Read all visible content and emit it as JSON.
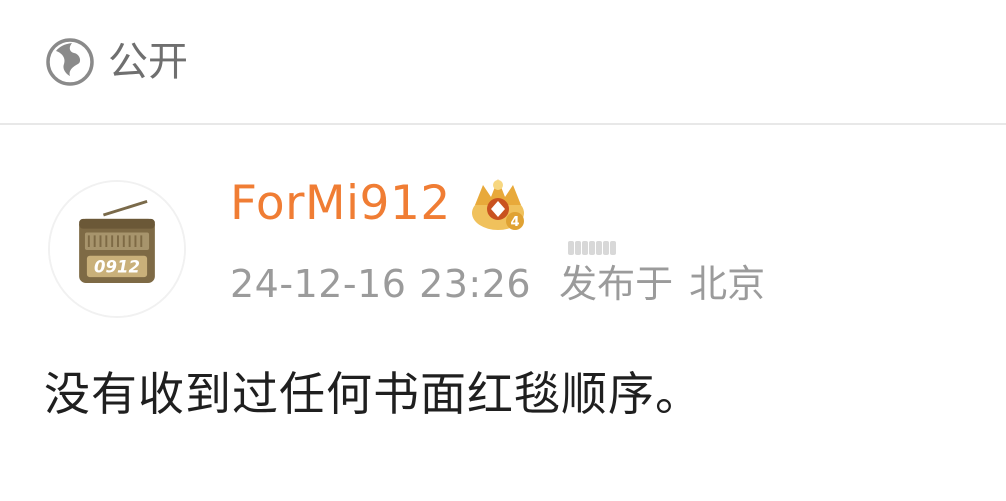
{
  "visibility": {
    "icon": "globe-icon",
    "label": "公开"
  },
  "post": {
    "avatar": {
      "badge_text": "0912"
    },
    "author": {
      "name": "ForMi912",
      "badge_icon": "crown-badge-icon",
      "badge_level": "4"
    },
    "timestamp": "24-12-16 23:26",
    "published_label": "发布于",
    "location": "北京",
    "content": "没有收到过任何书面红毯顺序。"
  },
  "colors": {
    "username": "#f07d34",
    "meta": "#9b9b9b",
    "content": "#1f1f1f",
    "divider": "#e8e8e8"
  }
}
